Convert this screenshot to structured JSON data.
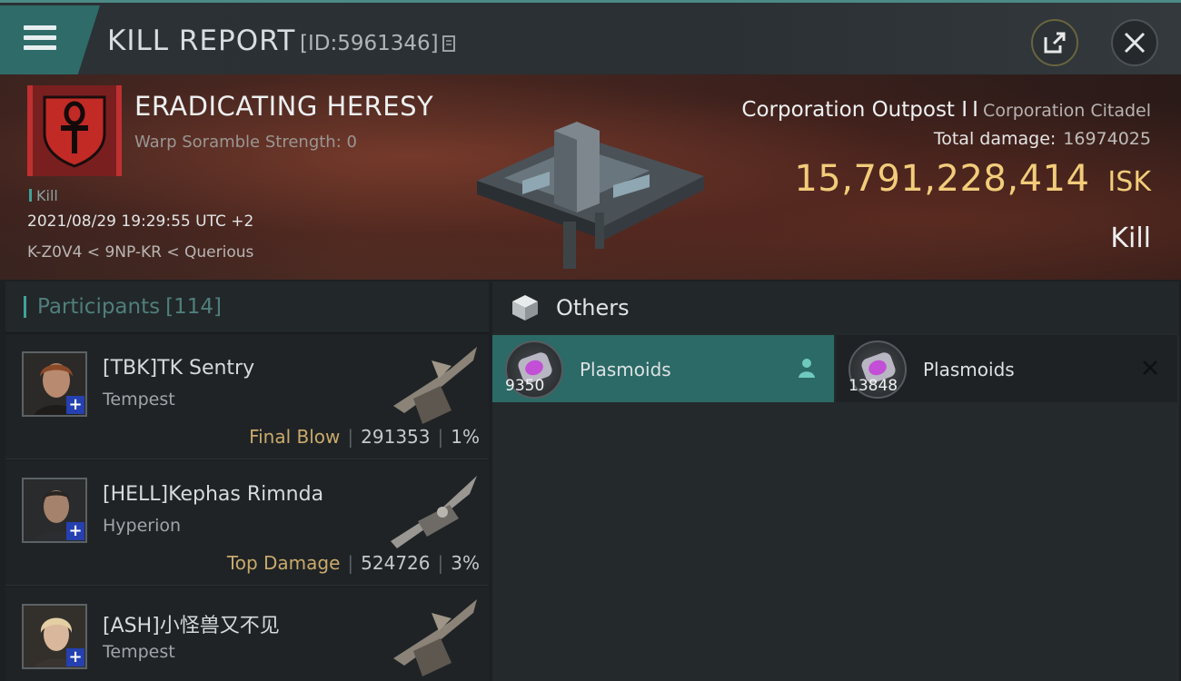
{
  "header": {
    "title": "KILL REPORT",
    "report_id": "[ID:5961346]"
  },
  "victim": {
    "corp_name": "ERADICATING HERESY",
    "warp_scramble": "Warp Soramble Strength: 0",
    "tag": "Kill",
    "timestamp": "2021/08/29 19:29:55 UTC +2",
    "location": "K-Z0V4 < 9NP-KR < Querious",
    "ship_name": "Corporation Outpost I",
    "ship_class": "Corporation Citadel",
    "total_damage_label": "Total damage:",
    "total_damage": "16974025",
    "isk_value": "15,791,228,414",
    "isk_unit": "ISK",
    "result": "Kill"
  },
  "participants": {
    "label": "Participants",
    "count": "[114]",
    "list": [
      {
        "name": "[TBK]TK Sentry",
        "ship": "Tempest",
        "badge": "Final Blow",
        "damage": "291353",
        "percent": "1%"
      },
      {
        "name": "[HELL]Kephas Rimnda",
        "ship": "Hyperion",
        "badge": "Top Damage",
        "damage": "524726",
        "percent": "3%"
      },
      {
        "name": "[ASH]小怪兽又不见",
        "ship": "Tempest",
        "badge": "",
        "damage": "",
        "percent": ""
      }
    ]
  },
  "others": {
    "label": "Others",
    "items": [
      {
        "name": "Plasmoids",
        "quantity": "9350",
        "selected": true
      },
      {
        "name": "Plasmoids",
        "quantity": "13848",
        "selected": false
      }
    ]
  },
  "colors": {
    "accent_teal": "#2f6b68",
    "isk_gold": "#f2cc7a",
    "badge_gold": "#c9aa6a"
  },
  "icons": {
    "menu": "menu-icon",
    "copy": "copy-icon",
    "share": "share-icon",
    "close": "close-icon",
    "others": "cube-icon",
    "item_owner": "person-icon",
    "item_remove": "x-icon"
  }
}
